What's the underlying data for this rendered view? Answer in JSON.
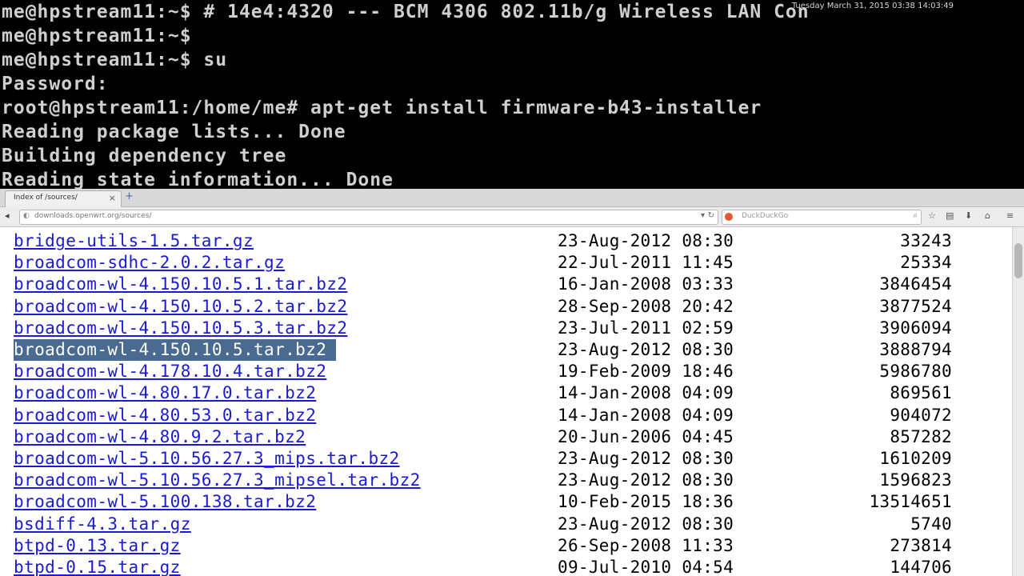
{
  "terminal": {
    "lines": [
      "me@hpstream11:~$ # 14e4:4320 --- BCM 4306 802.11b/g Wireless LAN Con",
      "me@hpstream11:~$",
      "me@hpstream11:~$ su",
      "Password:",
      "root@hpstream11:/home/me# apt-get install firmware-b43-installer",
      "Reading package lists... Done",
      "Building dependency tree",
      "Reading state information... Done"
    ],
    "clock": "Tuesday March 31, 2015 03:38 14:03:49"
  },
  "browser": {
    "tab_title": "Index of /sources/",
    "tab_close": "×",
    "new_tab": "+",
    "url": "downloads.openwrt.org/sources/",
    "search_placeholder": "DuckDuckGo",
    "icons": {
      "back": "◂",
      "lock": "◐",
      "dropdown": "▾",
      "reload": "↻",
      "search": "⌕",
      "star": "☆",
      "reader": "▤",
      "download": "⬇",
      "home": "⌂",
      "menu": "≡"
    }
  },
  "listing": [
    {
      "name": "bridge-utils-1.5.tar.gz",
      "date": "23-Aug-2012 08:30",
      "size": "33243"
    },
    {
      "name": "broadcom-sdhc-2.0.2.tar.gz",
      "date": "22-Jul-2011 11:45",
      "size": "25334"
    },
    {
      "name": "broadcom-wl-4.150.10.5.1.tar.bz2",
      "date": "16-Jan-2008 03:33",
      "size": "3846454"
    },
    {
      "name": "broadcom-wl-4.150.10.5.2.tar.bz2",
      "date": "28-Sep-2008 20:42",
      "size": "3877524"
    },
    {
      "name": "broadcom-wl-4.150.10.5.3.tar.bz2",
      "date": "23-Jul-2011 02:59",
      "size": "3906094"
    },
    {
      "name": "broadcom-wl-4.150.10.5.tar.bz2",
      "date": "23-Aug-2012 08:30",
      "size": "3888794",
      "selected": true
    },
    {
      "name": "broadcom-wl-4.178.10.4.tar.bz2",
      "date": "19-Feb-2009 18:46",
      "size": "5986780"
    },
    {
      "name": "broadcom-wl-4.80.17.0.tar.bz2",
      "date": "14-Jan-2008 04:09",
      "size": "869561"
    },
    {
      "name": "broadcom-wl-4.80.53.0.tar.bz2",
      "date": "14-Jan-2008 04:09",
      "size": "904072"
    },
    {
      "name": "broadcom-wl-4.80.9.2.tar.bz2",
      "date": "20-Jun-2006 04:45",
      "size": "857282"
    },
    {
      "name": "broadcom-wl-5.10.56.27.3_mips.tar.bz2",
      "date": "23-Aug-2012 08:30",
      "size": "1610209"
    },
    {
      "name": "broadcom-wl-5.10.56.27.3_mipsel.tar.bz2",
      "date": "23-Aug-2012 08:30",
      "size": "1596823"
    },
    {
      "name": "broadcom-wl-5.100.138.tar.bz2",
      "date": "10-Feb-2015 18:36",
      "size": "13514651"
    },
    {
      "name": "bsdiff-4.3.tar.gz",
      "date": "23-Aug-2012 08:30",
      "size": "5740"
    },
    {
      "name": "btpd-0.13.tar.gz",
      "date": "26-Sep-2008 11:33",
      "size": "273814"
    },
    {
      "name": "btpd-0.15.tar.gz",
      "date": "09-Jul-2010 04:54",
      "size": "144706"
    }
  ]
}
